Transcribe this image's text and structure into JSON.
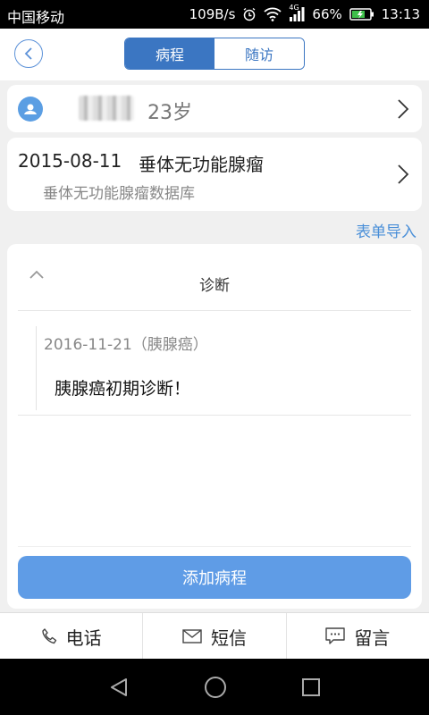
{
  "status": {
    "carrier": "中国移动",
    "speed": "109B/s",
    "network": "4G",
    "battery": "66%",
    "time": "13:13"
  },
  "header": {
    "tabs": [
      {
        "label": "病程",
        "active": true
      },
      {
        "label": "随访",
        "active": false
      }
    ]
  },
  "patient": {
    "age": "23岁"
  },
  "record": {
    "date": "2015-08-11",
    "title": "垂体无功能腺瘤",
    "database": "垂体无功能腺瘤数据库"
  },
  "import_label": "表单导入",
  "diagnosis": {
    "section_title": "诊断",
    "entry_date": "2016-11-21",
    "entry_tag": "（胰腺癌）",
    "entry_text": "胰腺癌初期诊断！",
    "add_button": "添加病程"
  },
  "actions": [
    {
      "label": "电话",
      "icon": "phone-icon"
    },
    {
      "label": "短信",
      "icon": "mail-icon"
    },
    {
      "label": "留言",
      "icon": "message-icon"
    }
  ],
  "colors": {
    "primary": "#3b76c2",
    "button": "#5f9ce6",
    "link": "#4a8fd8"
  }
}
